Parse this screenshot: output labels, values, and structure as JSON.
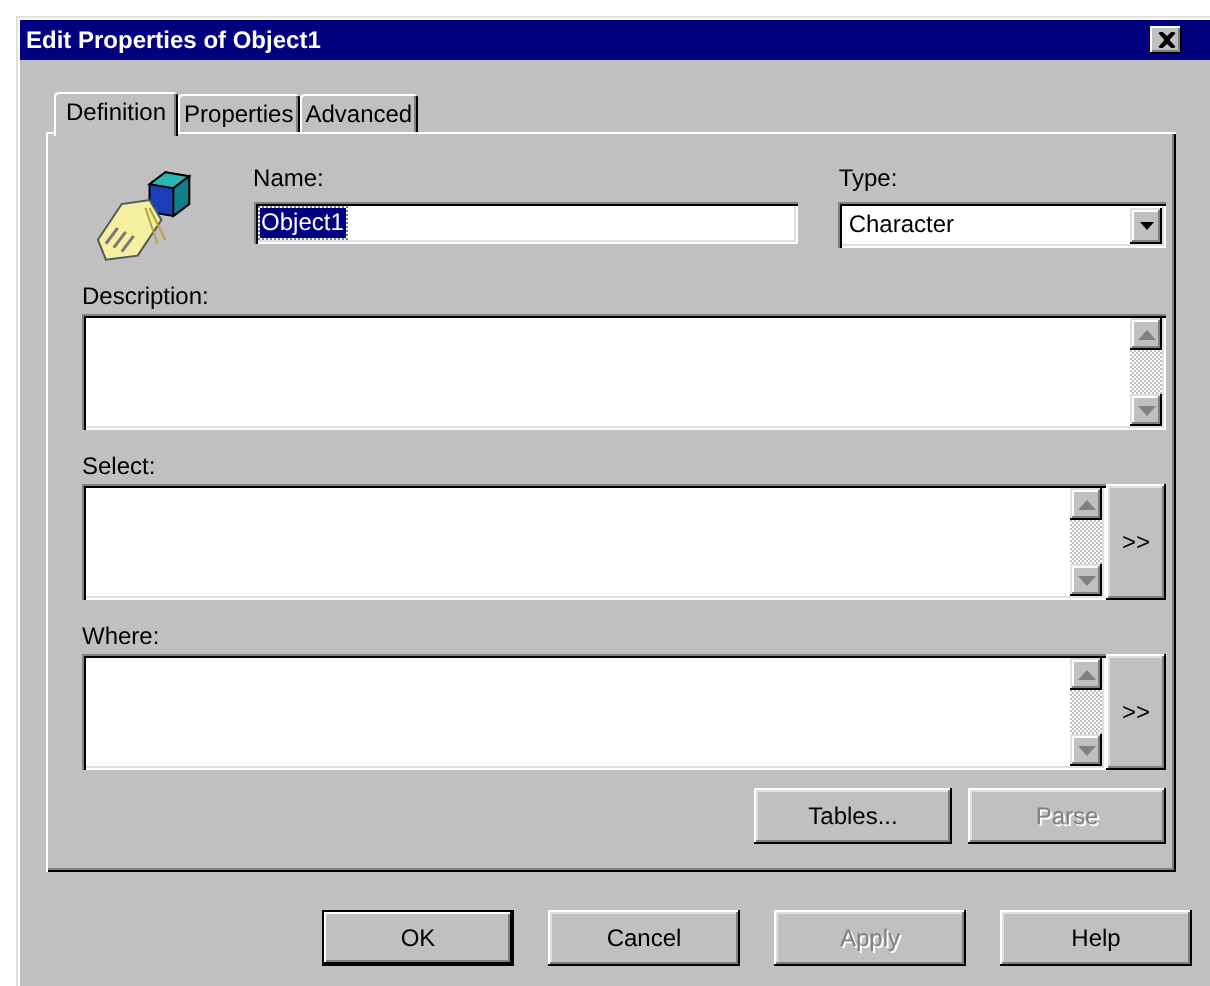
{
  "window": {
    "title": "Edit Properties of Object1"
  },
  "tabs": [
    {
      "label": "Definition",
      "selected": true
    },
    {
      "label": "Properties",
      "selected": false
    },
    {
      "label": "Advanced",
      "selected": false
    }
  ],
  "name": {
    "label": "Name:",
    "value": "Object1",
    "text_selected": true
  },
  "type": {
    "label": "Type:",
    "value": "Character"
  },
  "text_areas": [
    {
      "label": "Description:"
    },
    {
      "label": "Select:",
      "button": ">>"
    },
    {
      "label": "Where:",
      "button": ">>"
    }
  ],
  "panel_buttons": [
    {
      "label": "Tables...",
      "disabled": false
    },
    {
      "label": "Parse",
      "disabled": true
    }
  ],
  "dialog_buttons": [
    {
      "label": "OK",
      "disabled": false,
      "default": true
    },
    {
      "label": "Cancel",
      "disabled": false,
      "default": false
    },
    {
      "label": "Apply",
      "disabled": true,
      "default": false
    },
    {
      "label": "Help",
      "disabled": false,
      "default": false
    }
  ]
}
